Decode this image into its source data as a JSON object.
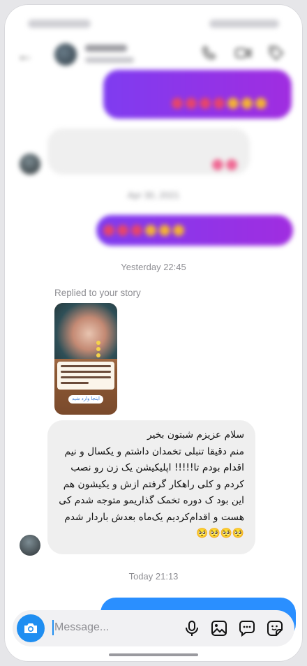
{
  "conversation": {
    "timestamps": {
      "yesterday": "Yesterday 22:45",
      "today": "Today 21:13"
    },
    "replied_label": "Replied to your story",
    "story": {
      "button_label": "اینجا وارد شید"
    },
    "message_text": "سلام عزیزم شبتون بخیر\nمنم دقیقا تنبلی تخمدان داشتم و یکسال و نیم اقدام بودم تا!!!!! اپلیکیشن یک زن رو نصب کردم و کلی راهکار گرفتم ازش و یکیشون هم این بود ک دوره تخمک گذاریمو متوجه شدم کی هست و اقدام‌کردیم یک‌ماه بعدش باردار شدم 🥺🥺🥺🥺"
  },
  "composer": {
    "placeholder": "Message..."
  },
  "colors": {
    "accent": "#1f8ef1",
    "outgoing_bubble": "#8a35e8",
    "incoming_bubble": "#efefef"
  },
  "icons": [
    "back-arrow-icon",
    "phone-icon",
    "video-icon",
    "tag-icon",
    "camera-icon",
    "mic-icon",
    "gallery-icon",
    "chat-bubble-icon",
    "sticker-icon"
  ]
}
